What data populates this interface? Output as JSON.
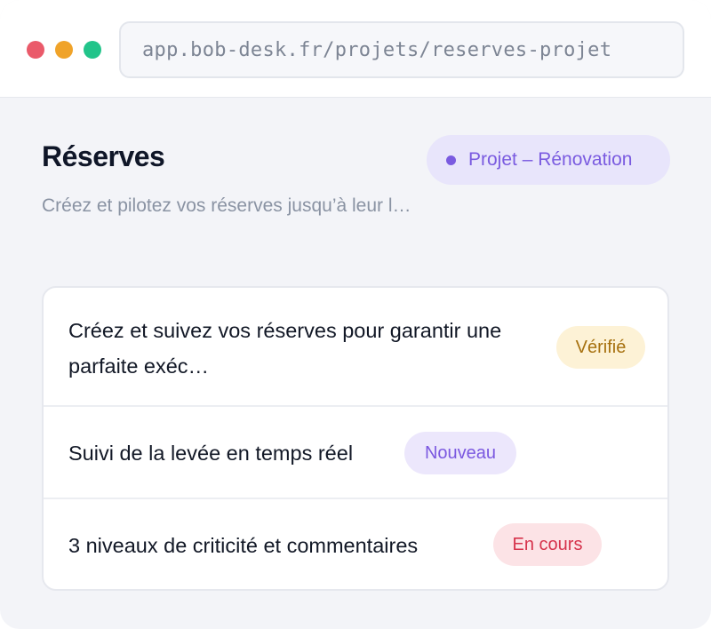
{
  "browser": {
    "url": "app.bob-desk.fr/projets/reserves-projet"
  },
  "header": {
    "title": "Réserves",
    "subtitle": "Créez et pilotez vos réserves jusqu’à leur l…",
    "project_badge": "Projet – Rénovation"
  },
  "features": [
    {
      "text": "Créez et suivez vos réserves pour garantir une parfaite exéc…",
      "status": "Vérifié"
    },
    {
      "text": "Suivi de la levée en temps réel",
      "status": "Nouveau"
    },
    {
      "text": "3 niveaux de criticité et commentaires",
      "status": "En cours"
    }
  ],
  "colors": {
    "window_dots": [
      "#ea5a6a",
      "#f0a329",
      "#22c48a"
    ],
    "accent_purple": "#7a5be0",
    "status_verified": "#a6700e",
    "status_new": "#7b58e0",
    "status_in_progress": "#d6334c"
  }
}
